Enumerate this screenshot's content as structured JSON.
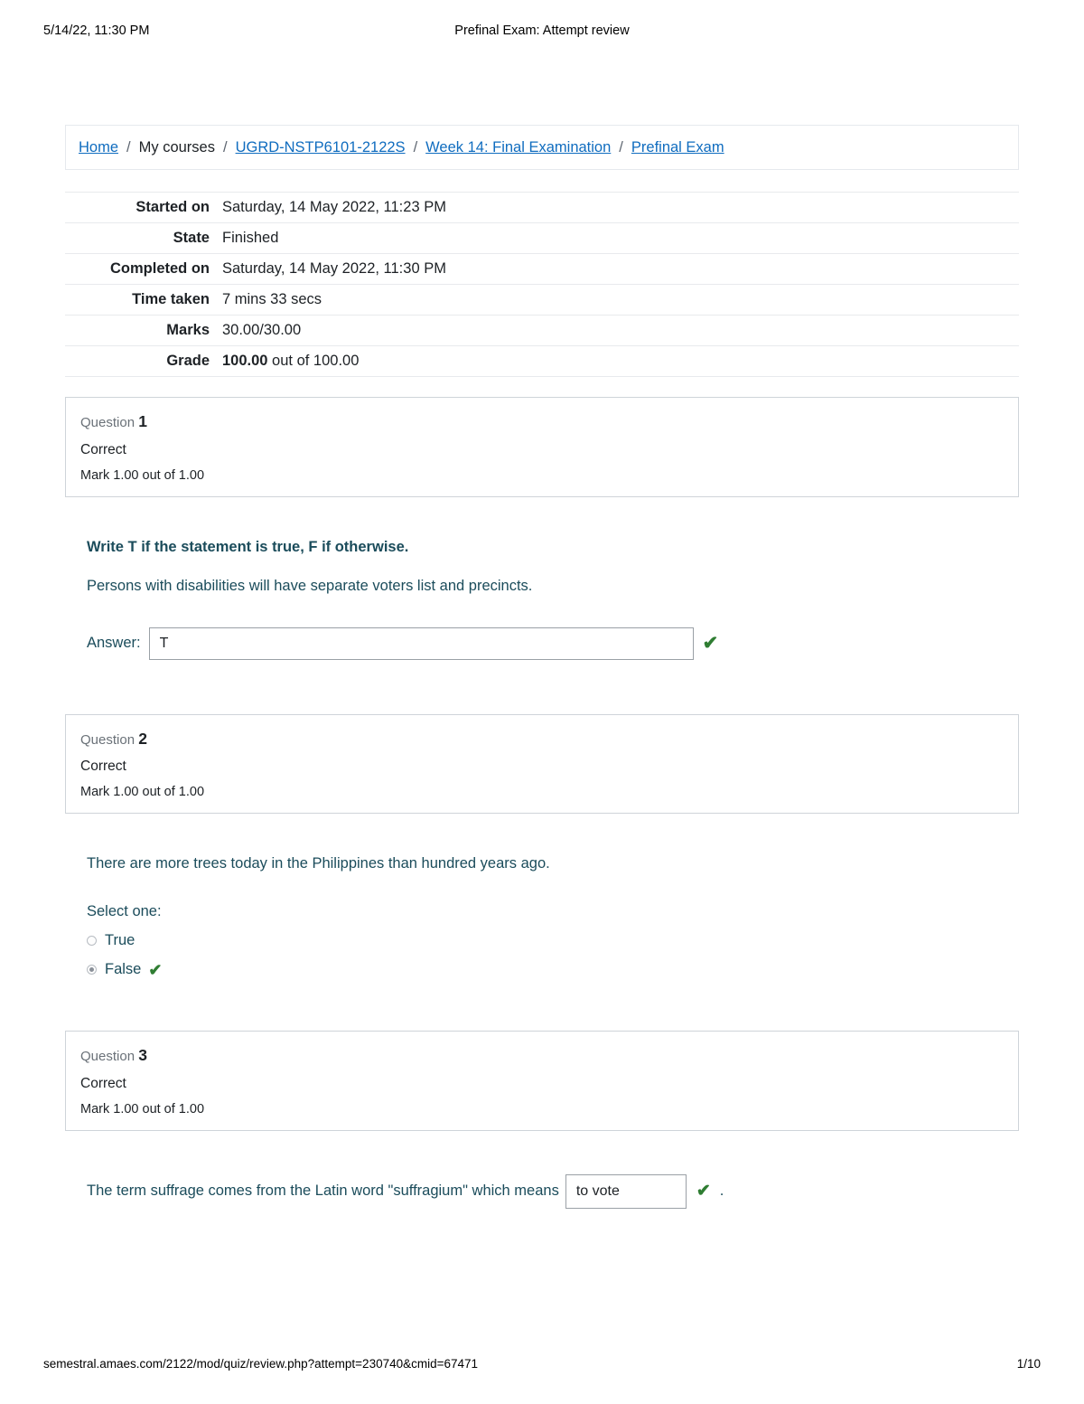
{
  "print_header": {
    "left": "5/14/22, 11:30 PM",
    "center": "Prefinal Exam: Attempt review"
  },
  "print_footer": {
    "url": "semestral.amaes.com/2122/mod/quiz/review.php?attempt=230740&cmid=67471",
    "page": "1/10"
  },
  "breadcrumb": {
    "items": [
      {
        "label": "Home",
        "link": true
      },
      {
        "label": "My courses",
        "link": false
      },
      {
        "label": "UGRD-NSTP6101-2122S",
        "link": true
      },
      {
        "label": "Week 14: Final Examination",
        "link": true
      },
      {
        "label": "Prefinal Exam",
        "link": true
      }
    ],
    "separator": "/"
  },
  "summary": {
    "rows": [
      {
        "label": "Started on",
        "value": "Saturday, 14 May 2022, 11:23 PM"
      },
      {
        "label": "State",
        "value": "Finished"
      },
      {
        "label": "Completed on",
        "value": "Saturday, 14 May 2022, 11:30 PM"
      },
      {
        "label": "Time taken",
        "value": "7 mins 33 secs"
      },
      {
        "label": "Marks",
        "value": "30.00/30.00"
      },
      {
        "label": "Grade",
        "value_bold": "100.00",
        "value_rest": " out of 100.00"
      }
    ]
  },
  "questions": [
    {
      "number_label": "Question",
      "number": "1",
      "state": "Correct",
      "mark": "Mark 1.00 out of 1.00",
      "instruction": "Write T if the statement is true, F if otherwise.",
      "text": "Persons with disabilities will have separate voters list and precincts.",
      "answer_label": "Answer:",
      "answer_value": "T",
      "correct_icon": "✔"
    },
    {
      "number_label": "Question",
      "number": "2",
      "state": "Correct",
      "mark": "Mark 1.00 out of 1.00",
      "text": "There are more trees today in the Philippines than hundred years ago.",
      "select_one_label": "Select one:",
      "options": [
        {
          "label": "True",
          "selected": false,
          "correct_icon": ""
        },
        {
          "label": "False",
          "selected": true,
          "correct_icon": "✔"
        }
      ]
    },
    {
      "number_label": "Question",
      "number": "3",
      "state": "Correct",
      "mark": "Mark 1.00 out of 1.00",
      "text_before": "The term suffrage comes from the Latin word \"suffragium\" which means",
      "answer_value": "to vote",
      "correct_icon": "✔",
      "text_after": "."
    }
  ],
  "colors": {
    "link": "#0f6cbf",
    "question_text": "#1b4c5b",
    "correct_green": "#2f7d32",
    "box_border": "#cfd4d9"
  }
}
